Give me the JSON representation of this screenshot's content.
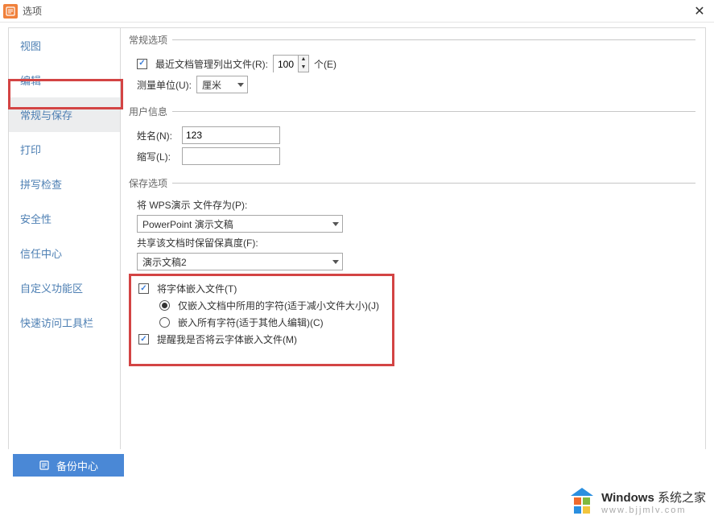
{
  "window": {
    "title": "选项",
    "close": "✕"
  },
  "sidebar": {
    "items": [
      {
        "label": "视图"
      },
      {
        "label": "编辑"
      },
      {
        "label": "常规与保存"
      },
      {
        "label": "打印"
      },
      {
        "label": "拼写检查"
      },
      {
        "label": "安全性"
      },
      {
        "label": "信任中心"
      },
      {
        "label": "自定义功能区"
      },
      {
        "label": "快速访问工具栏"
      }
    ],
    "active_index": 2
  },
  "general": {
    "legend": "常规选项",
    "recent_cb_label": "最近文档管理列出文件(R):",
    "recent_value": "100",
    "recent_suffix": "个(E)",
    "unit_label": "测量单位(U):",
    "unit_value": "厘米"
  },
  "user": {
    "legend": "用户信息",
    "name_label": "姓名(N):",
    "name_value": "123",
    "abbr_label": "缩写(L):",
    "abbr_value": ""
  },
  "save": {
    "legend": "保存选项",
    "format_label": "将 WPS演示 文件存为(P):",
    "format_value": "PowerPoint 演示文稿",
    "share_label": "共享该文档时保留保真度(F):",
    "share_value": "演示文稿2",
    "embed_fonts_label": "将字体嵌入文件(T)",
    "embed_opt1": "仅嵌入文档中所用的字符(适于减小文件大小)(J)",
    "embed_opt2": "嵌入所有字符(适于其他人编辑)(C)",
    "remind_label": "提醒我是否将云字体嵌入文件(M)"
  },
  "footer": {
    "backup_label": "备份中心"
  },
  "watermark": {
    "brand": "Windows",
    "suffix": "系统之家",
    "url": "www.bjjmlv.com"
  }
}
